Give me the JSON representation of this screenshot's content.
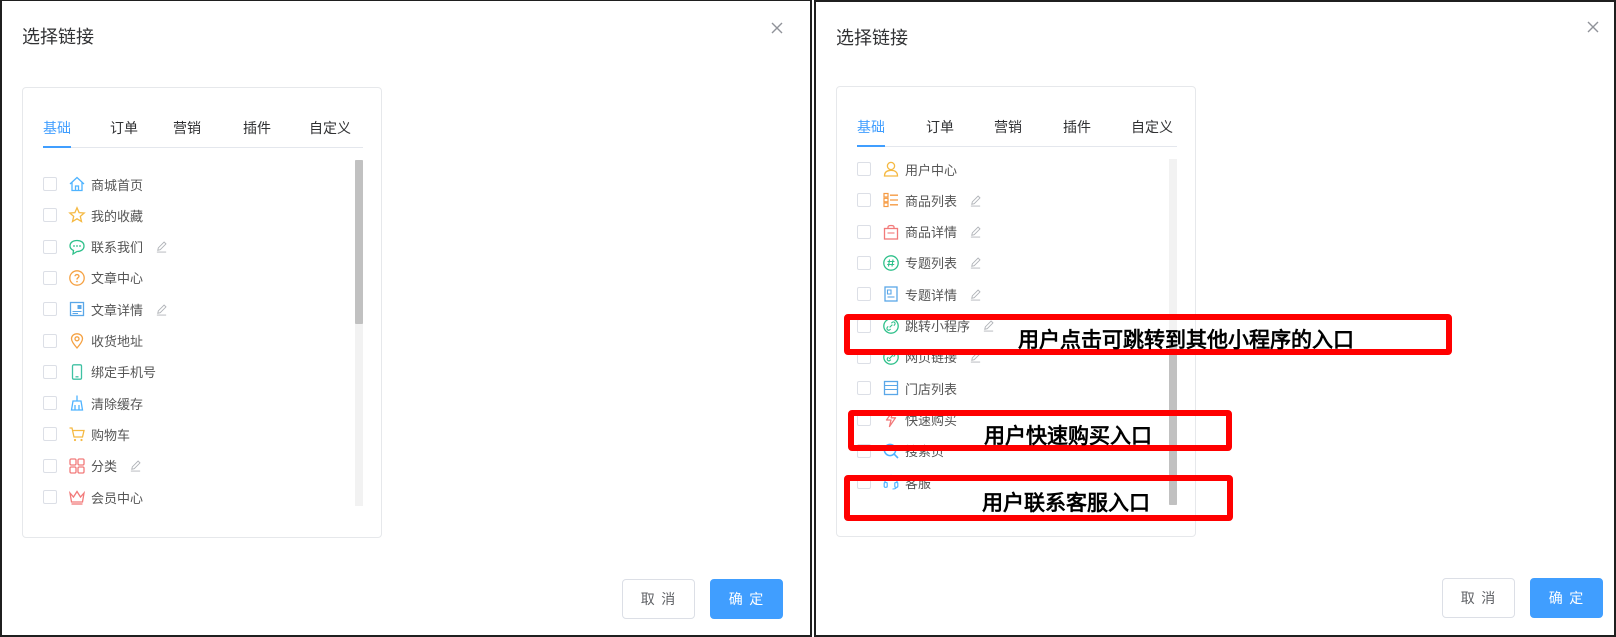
{
  "dialog_title": "选择链接",
  "tabs": [
    "基础",
    "订单",
    "营销",
    "插件",
    "自定义"
  ],
  "left_items": [
    {
      "label": "商城首页",
      "icon": "home-icon",
      "editable": false
    },
    {
      "label": "我的收藏",
      "icon": "star-icon",
      "editable": false
    },
    {
      "label": "联系我们",
      "icon": "chat-icon",
      "editable": true
    },
    {
      "label": "文章中心",
      "icon": "question-icon",
      "editable": false
    },
    {
      "label": "文章详情",
      "icon": "article-icon",
      "editable": true
    },
    {
      "label": "收货地址",
      "icon": "location-icon",
      "editable": false
    },
    {
      "label": "绑定手机号",
      "icon": "phone-icon",
      "editable": false
    },
    {
      "label": "清除缓存",
      "icon": "broom-icon",
      "editable": false
    },
    {
      "label": "购物车",
      "icon": "cart-icon",
      "editable": false
    },
    {
      "label": "分类",
      "icon": "category-icon",
      "editable": true
    },
    {
      "label": "会员中心",
      "icon": "crown-icon",
      "editable": false
    }
  ],
  "right_items": [
    {
      "label": "用户中心",
      "icon": "user-icon",
      "editable": false
    },
    {
      "label": "商品列表",
      "icon": "list-icon",
      "editable": true
    },
    {
      "label": "商品详情",
      "icon": "bag-icon",
      "editable": true
    },
    {
      "label": "专题列表",
      "icon": "hash-icon",
      "editable": true
    },
    {
      "label": "专题详情",
      "icon": "doc-icon",
      "editable": true
    },
    {
      "label": "跳转小程序",
      "icon": "link-icon",
      "editable": true
    },
    {
      "label": "网页链接",
      "icon": "web-link-icon",
      "editable": true
    },
    {
      "label": "门店列表",
      "icon": "store-icon",
      "editable": false
    },
    {
      "label": "快速购买",
      "icon": "lightning-icon",
      "editable": false
    },
    {
      "label": "搜索页",
      "icon": "search-icon",
      "editable": false
    },
    {
      "label": "客服",
      "icon": "headset-icon",
      "editable": false
    }
  ],
  "annotations": {
    "mini_program": "用户点击可跳转到其他小程序的入口",
    "quick_buy": "用户快速购买入口",
    "customer_service": "用户联系客服入口"
  },
  "buttons": {
    "cancel": "取 消",
    "ok": "确 定"
  },
  "colors": {
    "accent": "#409eff",
    "annotation_border": "#ff0000"
  }
}
